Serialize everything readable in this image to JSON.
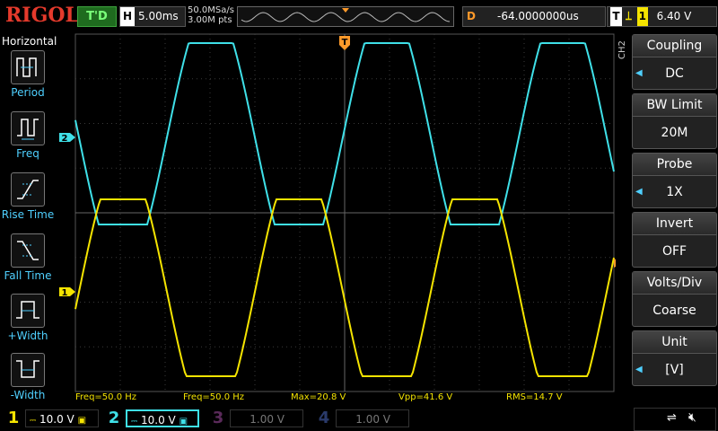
{
  "header": {
    "logo": "RIGOL",
    "run_status": "T'D",
    "timebase": {
      "key": "H",
      "value": "5.00ms"
    },
    "sample_rate": "50.0MSa/s",
    "memory_depth": "3.00M pts",
    "delay": {
      "key": "D",
      "value": "-64.0000000us"
    },
    "trigger": {
      "key": "T",
      "source": "1",
      "level": "6.40 V"
    }
  },
  "left_menu": {
    "title": "Horizontal",
    "items": [
      {
        "label": "Period"
      },
      {
        "label": "Freq"
      },
      {
        "label": "Rise Time"
      },
      {
        "label": "Fall Time"
      },
      {
        "label": "+Width"
      },
      {
        "label": "-Width"
      }
    ]
  },
  "right_menu": {
    "channel_tag": "CH2",
    "items": [
      {
        "title": "Coupling",
        "value": "DC"
      },
      {
        "title": "BW Limit",
        "value": "20M"
      },
      {
        "title": "Probe",
        "value": "1X"
      },
      {
        "title": "Invert",
        "value": "OFF"
      },
      {
        "title": "Volts/Div",
        "value": "Coarse"
      },
      {
        "title": "Unit",
        "value": "[V]"
      }
    ]
  },
  "measurements": [
    "Freq=50.0 Hz",
    "Freq=50.0 Hz",
    "Max=20.8 V",
    "Vpp=41.6 V",
    "RMS=14.7 V"
  ],
  "channels": [
    {
      "number": "1",
      "scale": "10.0 V",
      "color": "#f5e400",
      "active": true
    },
    {
      "number": "2",
      "scale": "10.0 V",
      "color": "#3fe0e8",
      "active": true
    },
    {
      "number": "3",
      "scale": "1.00 V",
      "color": "#c040c0",
      "active": false
    },
    {
      "number": "4",
      "scale": "1.00 V",
      "color": "#3a6ad8",
      "active": false
    }
  ],
  "markers": {
    "ch1": "1",
    "ch2": "2",
    "trigger": "T"
  },
  "colors": {
    "ch1": "#f5e400",
    "ch2": "#3fe0e8",
    "trigger": "#ff9a2a",
    "accent": "#4fd0ff",
    "logo": "#e53a2c"
  }
}
